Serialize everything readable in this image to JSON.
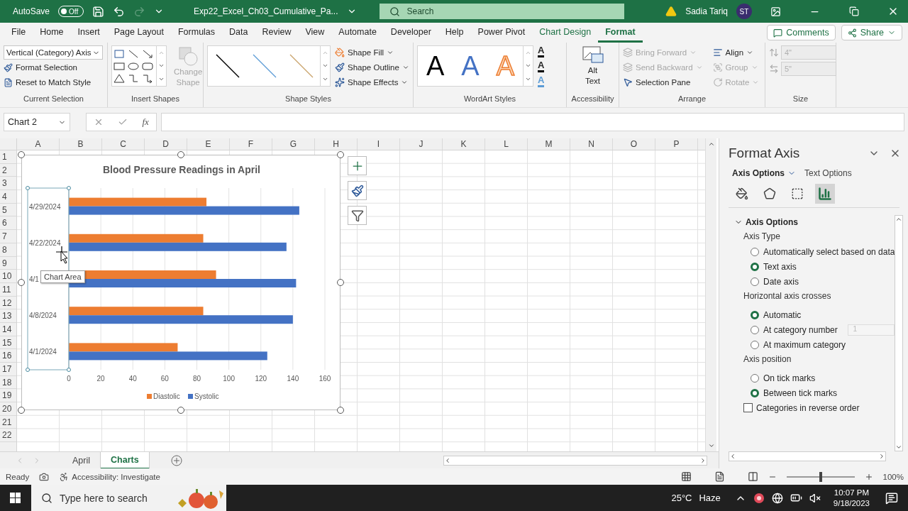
{
  "title_bar": {
    "autosave": {
      "label": "AutoSave",
      "toggle_text": "Off",
      "on": false
    },
    "file_name": "Exp22_Excel_Ch03_Cumulative_Pa...",
    "search_placeholder": "Search",
    "user_name": "Sadia Tariq",
    "user_initials": "ST"
  },
  "ribbon_tabs": [
    {
      "label": "File",
      "selected": false,
      "contextual": false
    },
    {
      "label": "Home",
      "selected": false,
      "contextual": false
    },
    {
      "label": "Insert",
      "selected": false,
      "contextual": false
    },
    {
      "label": "Page Layout",
      "selected": false,
      "contextual": false
    },
    {
      "label": "Formulas",
      "selected": false,
      "contextual": false
    },
    {
      "label": "Data",
      "selected": false,
      "contextual": false
    },
    {
      "label": "Review",
      "selected": false,
      "contextual": false
    },
    {
      "label": "View",
      "selected": false,
      "contextual": false
    },
    {
      "label": "Automate",
      "selected": false,
      "contextual": false
    },
    {
      "label": "Developer",
      "selected": false,
      "contextual": false
    },
    {
      "label": "Help",
      "selected": false,
      "contextual": false
    },
    {
      "label": "Power Pivot",
      "selected": false,
      "contextual": false
    },
    {
      "label": "Chart Design",
      "selected": false,
      "contextual": true
    },
    {
      "label": "Format",
      "selected": true,
      "contextual": true
    }
  ],
  "comments_button": "Comments",
  "share_button": "Share",
  "current_selection": {
    "dropdown": "Vertical (Category) Axis",
    "commands": [
      "Format Selection",
      "Reset to Match Style"
    ],
    "label": "Current Selection"
  },
  "insert_shapes": {
    "change_shape": {
      "lines": [
        "Change",
        "Shape"
      ],
      "disabled": true
    },
    "label": "Insert Shapes"
  },
  "shape_styles": {
    "commands": [
      "Shape Fill",
      "Shape Outline",
      "Shape Effects"
    ],
    "label": "Shape Styles"
  },
  "wordart_styles": {
    "samples": [
      "A",
      "A",
      "A"
    ],
    "text_buttons": [
      "A",
      "A",
      "A"
    ],
    "label": "WordArt Styles"
  },
  "accessibility": {
    "command": [
      "Alt",
      "Text"
    ],
    "label": "Accessibility"
  },
  "arrange": {
    "commands": [
      {
        "label": "Bring Forward",
        "disabled": true
      },
      {
        "label": "Send Backward",
        "disabled": true
      },
      {
        "label": "Selection Pane",
        "disabled": false
      },
      {
        "label": "Align",
        "disabled": false
      },
      {
        "label": "Group",
        "disabled": true
      },
      {
        "label": "Rotate",
        "disabled": true
      }
    ],
    "label": "Arrange"
  },
  "size": {
    "fields": [
      {
        "value": "4\"",
        "disabled": true
      },
      {
        "value": "5\"",
        "disabled": true
      }
    ],
    "label": "Size"
  },
  "formula_bar": {
    "name_box": "Chart 2",
    "function_label": "fx"
  },
  "columns": [
    "A",
    "B",
    "C",
    "D",
    "E",
    "F",
    "G",
    "H",
    "I",
    "J",
    "K",
    "L",
    "M",
    "N",
    "O",
    "P"
  ],
  "rows": [
    "1",
    "2",
    "3",
    "4",
    "5",
    "6",
    "7",
    "8",
    "9",
    "10",
    "11",
    "12",
    "13",
    "14",
    "15",
    "16",
    "17",
    "18",
    "19",
    "20",
    "21",
    "22"
  ],
  "chart": {
    "tooltip": "Chart Area",
    "chart_data": {
      "type": "bar",
      "orientation": "horizontal",
      "title": "Blood Pressure Readings in April",
      "categories": [
        "4/29/2024",
        "4/22/2024",
        "4/1",
        "4/8/2024",
        "4/1/2024"
      ],
      "series": [
        {
          "name": "Diastolic",
          "color": "#ed7d31",
          "values": [
            86,
            84,
            92,
            84,
            68
          ]
        },
        {
          "name": "Systolic",
          "color": "#4472c4",
          "values": [
            144,
            136,
            142,
            140,
            124
          ]
        }
      ],
      "xlim": [
        0,
        160
      ],
      "xticks": [
        0,
        20,
        40,
        60,
        80,
        100,
        120,
        140,
        160
      ],
      "grid": true,
      "legend": true
    }
  },
  "format_pane": {
    "title": "Format Axis",
    "tabs": [
      {
        "label": "Axis Options",
        "selected": true
      },
      {
        "label": "Text Options",
        "selected": false
      }
    ],
    "icon_tabs": [
      {
        "kind": "fill",
        "selected": false
      },
      {
        "kind": "effects",
        "selected": false
      },
      {
        "kind": "size",
        "selected": false
      },
      {
        "kind": "options",
        "selected": true
      }
    ],
    "section": {
      "title": "Axis Options",
      "expanded": true,
      "groups": [
        {
          "heading": "Axis Type",
          "options": [
            {
              "label": "Automatically select based on data",
              "selected": false
            },
            {
              "label": "Text axis",
              "selected": true
            },
            {
              "label": "Date axis",
              "selected": false
            }
          ]
        },
        {
          "heading": "Horizontal axis crosses",
          "options": [
            {
              "label": "Automatic",
              "selected": true
            },
            {
              "label": "At category number",
              "selected": false,
              "field": "1"
            },
            {
              "label": "At maximum category",
              "selected": false
            }
          ]
        },
        {
          "heading": "Axis position",
          "options": [
            {
              "label": "On tick marks",
              "selected": false
            },
            {
              "label": "Between tick marks",
              "selected": true
            }
          ]
        }
      ],
      "checkbox": {
        "label": "Categories in reverse order",
        "checked": false
      }
    }
  },
  "sheet_tabs": [
    {
      "label": "April",
      "selected": false
    },
    {
      "label": "Charts",
      "selected": true
    }
  ],
  "status_bar": {
    "mode": "Ready",
    "accessibility": "Accessibility: Investigate",
    "zoom": "100%",
    "zoom_slider": {
      "level": 0.5
    }
  },
  "taskbar": {
    "search_placeholder": "Type here to search",
    "temperature": "25°C",
    "weather": "Haze",
    "time": "10:07 PM",
    "date": "9/18/2023"
  }
}
